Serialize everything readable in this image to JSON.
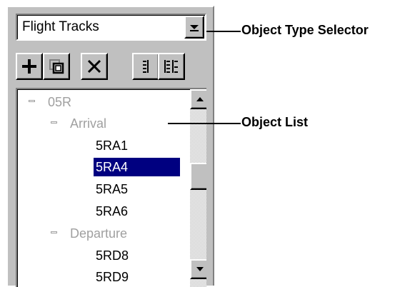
{
  "object_type_selector": {
    "value": "Flight Tracks",
    "icon": "chevron-down-icon"
  },
  "toolbar": {
    "buttons": [
      {
        "name": "add-button",
        "icon": "plus-icon"
      },
      {
        "name": "copy-button",
        "icon": "copy-icon"
      },
      {
        "name": "delete-button",
        "icon": "close-icon"
      },
      {
        "name": "collapse-all-button",
        "icon": "collapse-list-icon"
      },
      {
        "name": "expand-all-button",
        "icon": "expand-list-icon"
      }
    ]
  },
  "object_list": {
    "items": [
      {
        "label": "05R",
        "level": 0,
        "type": "group",
        "expanded": true
      },
      {
        "label": "Arrival",
        "level": 1,
        "type": "group",
        "expanded": true
      },
      {
        "label": "5RA1",
        "level": 2,
        "type": "leaf",
        "selected": false
      },
      {
        "label": "5RA4",
        "level": 2,
        "type": "leaf",
        "selected": true
      },
      {
        "label": "5RA5",
        "level": 2,
        "type": "leaf",
        "selected": false
      },
      {
        "label": "5RA6",
        "level": 2,
        "type": "leaf",
        "selected": false
      },
      {
        "label": "Departure",
        "level": 1,
        "type": "group",
        "expanded": true
      },
      {
        "label": "5RD8",
        "level": 2,
        "type": "leaf",
        "selected": false
      },
      {
        "label": "5RD9",
        "level": 2,
        "type": "leaf",
        "selected": false
      }
    ],
    "selection_color": "#000080",
    "group_text_color": "#a0a0a0"
  },
  "callouts": {
    "object_type_selector": "Object Type Selector",
    "object_list": "Object List"
  },
  "colors": {
    "panel_background": "#c0c0c0",
    "field_background": "#ffffff"
  }
}
